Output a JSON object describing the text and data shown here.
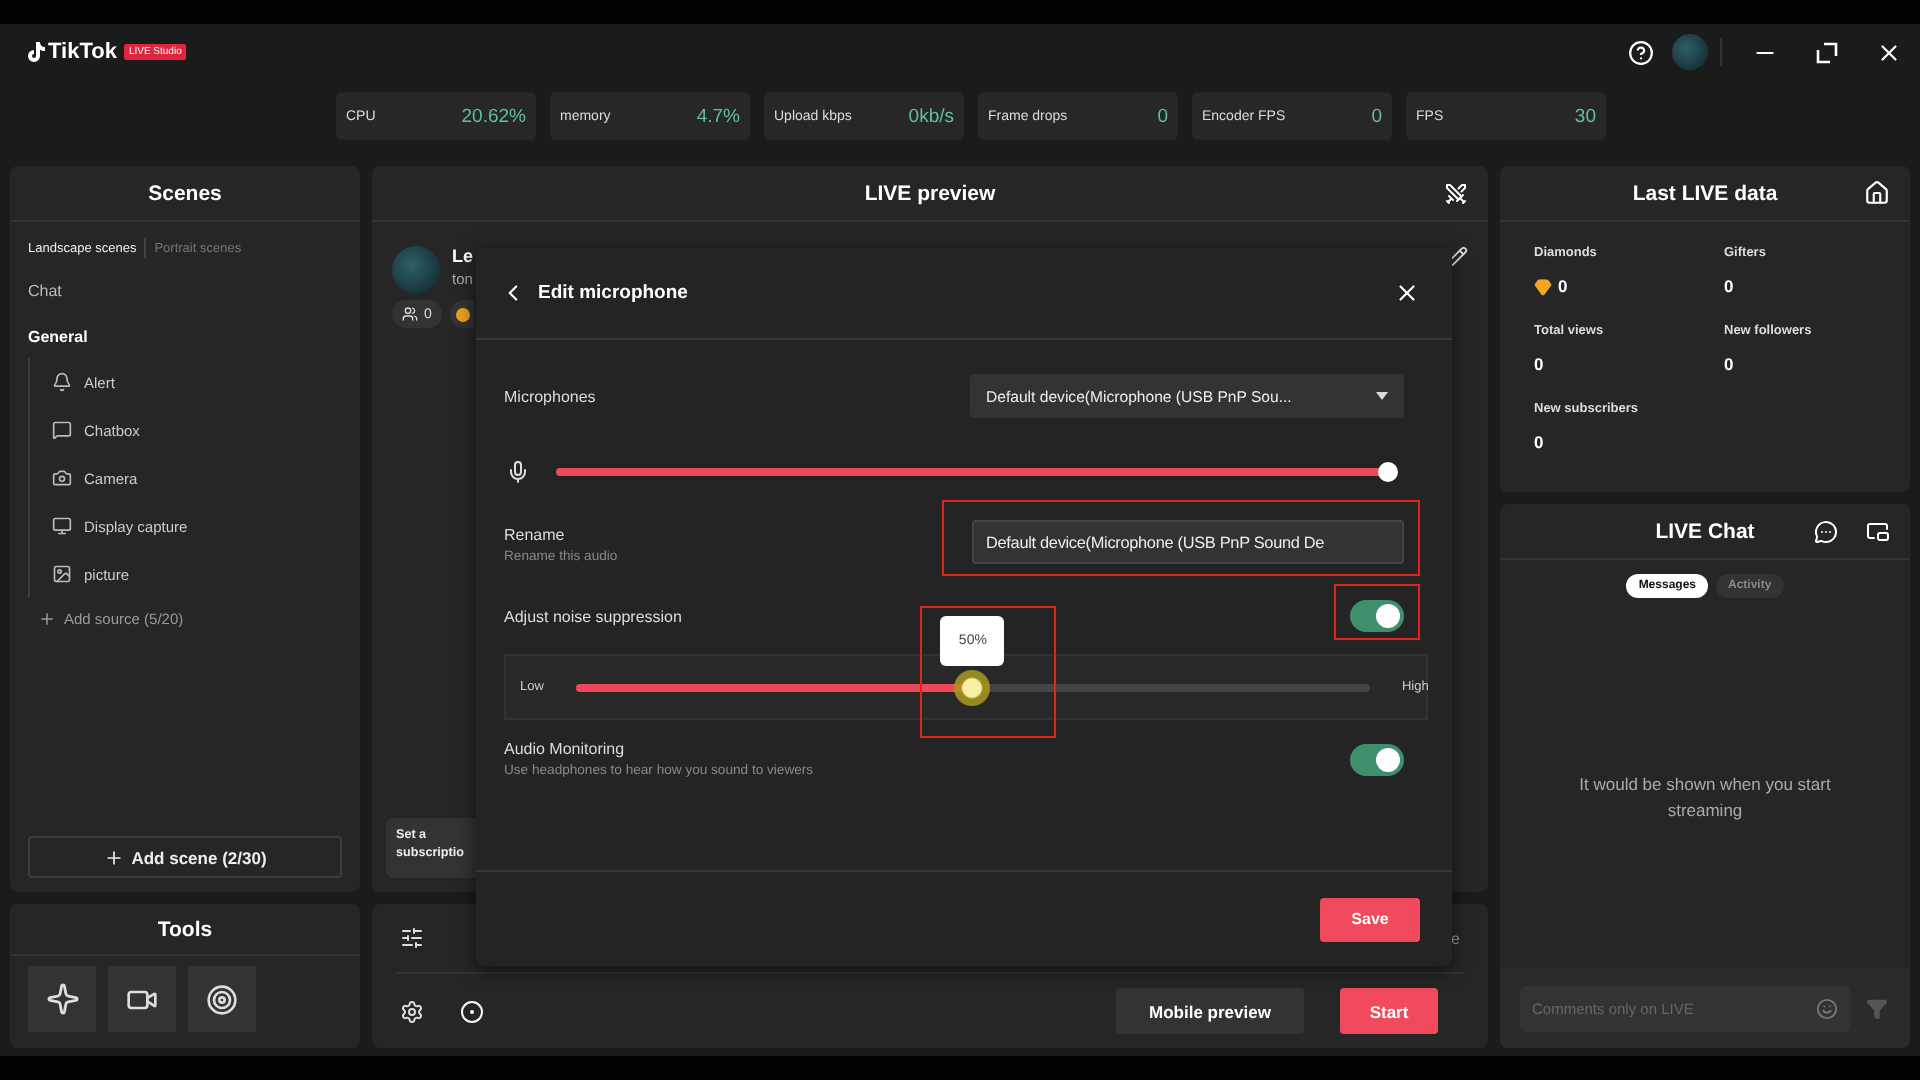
{
  "app": {
    "logo": "TikTok",
    "badge": "LIVE Studio"
  },
  "stats": [
    {
      "label": "CPU",
      "value": "20.62%"
    },
    {
      "label": "memory",
      "value": "4.7%"
    },
    {
      "label": "Upload kbps",
      "value": "0kb/s"
    },
    {
      "label": "Frame drops",
      "value": "0"
    },
    {
      "label": "Encoder FPS",
      "value": "0"
    },
    {
      "label": "FPS",
      "value": "30"
    }
  ],
  "scenes": {
    "title": "Scenes",
    "tabs": [
      {
        "label": "Landscape scenes",
        "selected": true
      },
      {
        "label": "Portrait scenes",
        "selected": false
      }
    ],
    "scene_list": [
      {
        "name": "Chat",
        "selected": false
      },
      {
        "name": "General",
        "selected": true
      }
    ],
    "sources": [
      {
        "name": "Alert",
        "kind": "alert"
      },
      {
        "name": "Chatbox",
        "kind": "chatbox"
      },
      {
        "name": "Camera",
        "kind": "camera"
      },
      {
        "name": "Display capture",
        "kind": "display"
      },
      {
        "name": "picture",
        "kind": "picture"
      }
    ],
    "add_source": "Add source (5/20)",
    "add_scene": "Add scene (2/30)"
  },
  "tools": {
    "title": "Tools"
  },
  "preview": {
    "title": "LIVE preview",
    "host_name": "Le",
    "host_handle": "ton",
    "viewer_count": "0",
    "subscription_card": "Set a subscriptio",
    "partial_text": "e",
    "mobile_preview": "Mobile preview",
    "start": "Start"
  },
  "modal": {
    "title": "Edit microphone",
    "microphones": {
      "label": "Microphones",
      "value": "Default device(Microphone (USB PnP Sou..."
    },
    "volume": {
      "level": 1
    },
    "rename": {
      "label": "Rename",
      "hint": "Rename this audio",
      "value": "Default device(Microphone (USB PnP Sound De",
      "highlighted": true
    },
    "noise": {
      "label": "Adjust noise suppression",
      "on": true,
      "switch_highlighted": true,
      "low": "Low",
      "high": "High",
      "level": 0.5,
      "tooltip": "50%",
      "slider_highlighted": true
    },
    "monitoring": {
      "label": "Audio Monitoring",
      "hint": "Use headphones to hear how you sound to viewers",
      "on": true
    },
    "save": "Save"
  },
  "last_live": {
    "title": "Last LIVE data",
    "metrics": [
      {
        "label": "Diamonds",
        "value": "0",
        "kind": "diamond"
      },
      {
        "label": "Gifters",
        "value": "0",
        "kind": "plain"
      },
      {
        "label": "Total views",
        "value": "0",
        "kind": "plain"
      },
      {
        "label": "New followers",
        "value": "0",
        "kind": "plain"
      },
      {
        "label": "New subscribers",
        "value": "0",
        "kind": "plain"
      }
    ]
  },
  "chat": {
    "title": "LIVE Chat",
    "tabs": [
      {
        "label": "Messages",
        "selected": true
      },
      {
        "label": "Activity",
        "selected": false
      }
    ],
    "empty": "It would be shown when you start streaming",
    "input": {
      "placeholder": "Comments only on LIVE"
    }
  }
}
